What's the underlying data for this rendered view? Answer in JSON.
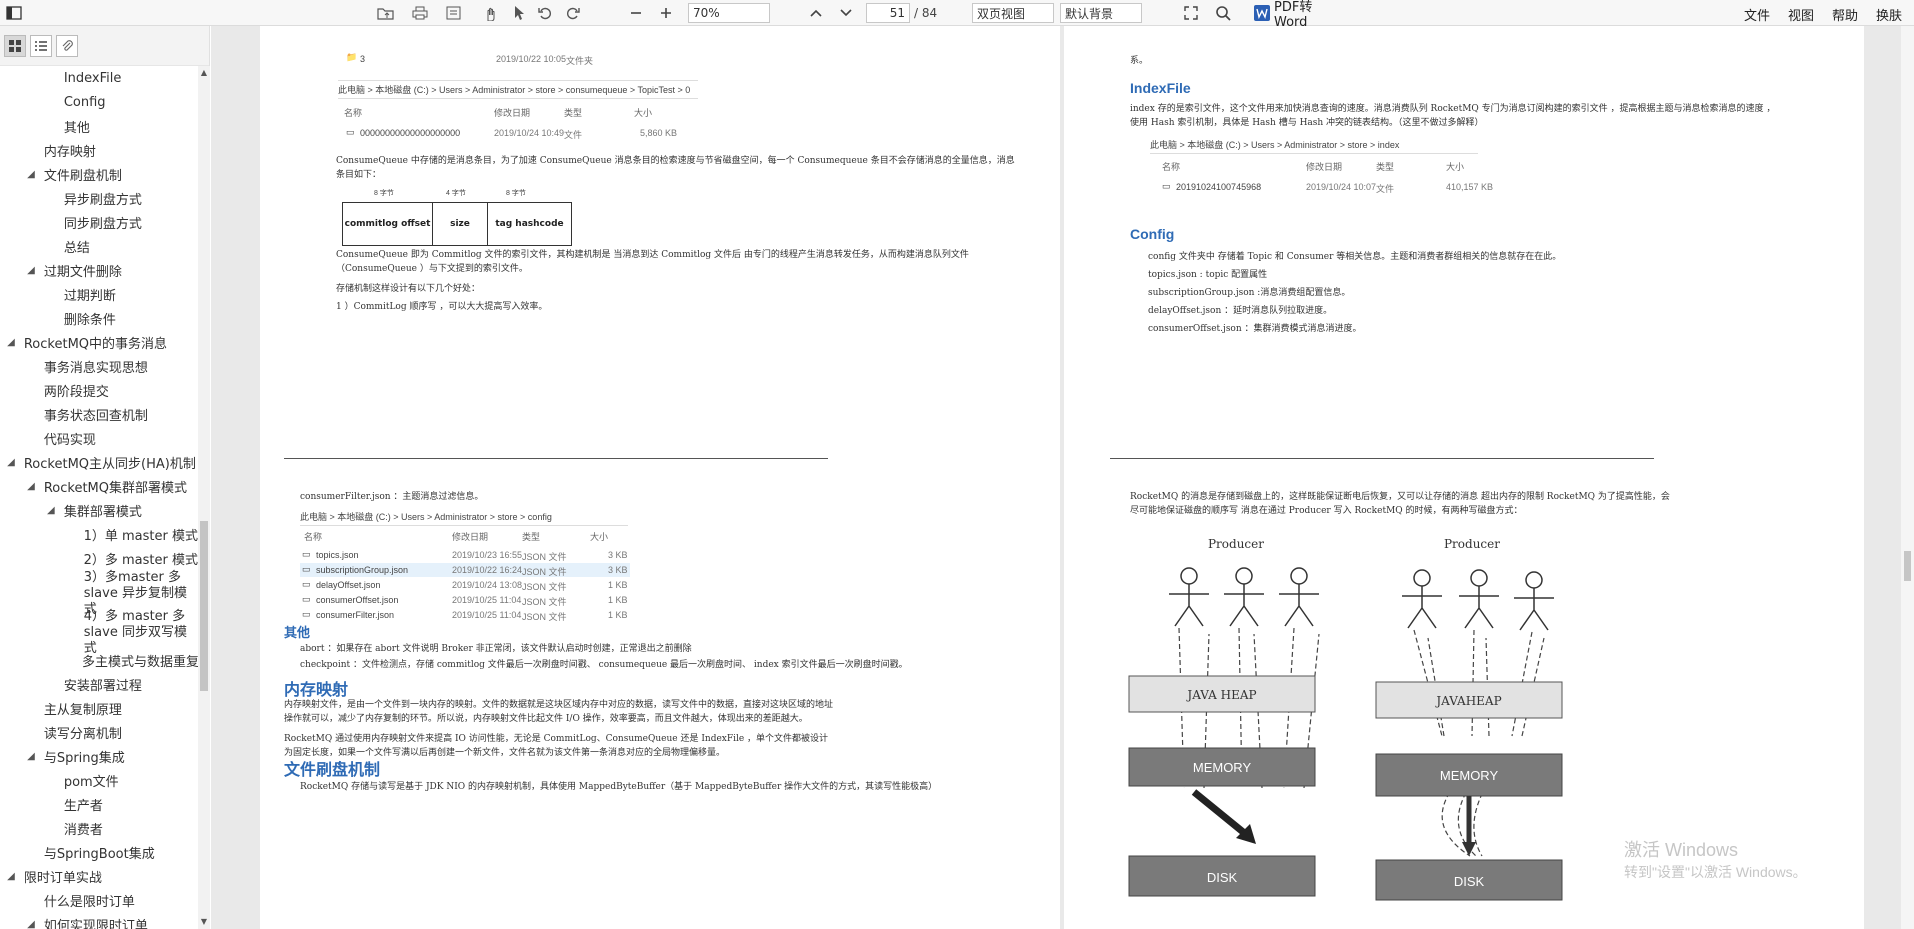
{
  "toolbar": {
    "zoom": "70%",
    "page_current": "51",
    "page_total": "/ 84",
    "view_mode": "双页视图",
    "background": "默认背景",
    "pdf_to_word": "PDF转Word",
    "menus": [
      "文件",
      "视图",
      "帮助",
      "换肤"
    ]
  },
  "sidebar": {
    "items": [
      {
        "label": "IndexFile",
        "level": 3,
        "arrow": ""
      },
      {
        "label": "Config",
        "level": 3,
        "arrow": ""
      },
      {
        "label": "其他",
        "level": 3,
        "arrow": ""
      },
      {
        "label": "内存映射",
        "level": 2,
        "arrow": ""
      },
      {
        "label": "文件刷盘机制",
        "level": 2,
        "arrow": "◢"
      },
      {
        "label": "异步刷盘方式",
        "level": 3,
        "arrow": ""
      },
      {
        "label": "同步刷盘方式",
        "level": 3,
        "arrow": ""
      },
      {
        "label": "总结",
        "level": 3,
        "arrow": ""
      },
      {
        "label": "过期文件删除",
        "level": 2,
        "arrow": "◢"
      },
      {
        "label": "过期判断",
        "level": 3,
        "arrow": ""
      },
      {
        "label": "删除条件",
        "level": 3,
        "arrow": ""
      },
      {
        "label": "RocketMQ中的事务消息",
        "level": 1,
        "arrow": "◢"
      },
      {
        "label": "事务消息实现思想",
        "level": 2,
        "arrow": ""
      },
      {
        "label": "两阶段提交",
        "level": 2,
        "arrow": ""
      },
      {
        "label": "事务状态回查机制",
        "level": 2,
        "arrow": ""
      },
      {
        "label": "代码实现",
        "level": 2,
        "arrow": ""
      },
      {
        "label": "RocketMQ主从同步(HA)机制",
        "level": 1,
        "arrow": "◢"
      },
      {
        "label": "RocketMQ集群部署模式",
        "level": 2,
        "arrow": "◢"
      },
      {
        "label": "集群部署模式",
        "level": 3,
        "arrow": "◢"
      },
      {
        "label": "1）单 master 模式",
        "level": 4,
        "arrow": ""
      },
      {
        "label": "2）多 master 模式",
        "level": 4,
        "arrow": ""
      },
      {
        "label": "3）多master 多 slave 异步复制模式",
        "level": 4,
        "arrow": "",
        "multi": true
      },
      {
        "label": "4）多 master 多 slave 同步双写模式",
        "level": 4,
        "arrow": "",
        "multi": true
      },
      {
        "label": "多主模式与数据重复",
        "level": 4,
        "arrow": ""
      },
      {
        "label": "安装部署过程",
        "level": 3,
        "arrow": ""
      },
      {
        "label": "主从复制原理",
        "level": 2,
        "arrow": ""
      },
      {
        "label": "读写分离机制",
        "level": 2,
        "arrow": ""
      },
      {
        "label": "与Spring集成",
        "level": 2,
        "arrow": "◢"
      },
      {
        "label": "pom文件",
        "level": 3,
        "arrow": ""
      },
      {
        "label": "生产者",
        "level": 3,
        "arrow": ""
      },
      {
        "label": "消费者",
        "level": 3,
        "arrow": ""
      },
      {
        "label": "与SpringBoot集成",
        "level": 2,
        "arrow": ""
      },
      {
        "label": "限时订单实战",
        "level": 1,
        "arrow": "◢"
      },
      {
        "label": "什么是限时订单",
        "level": 2,
        "arrow": ""
      },
      {
        "label": "如何实现限时订单",
        "level": 2,
        "arrow": "◢"
      }
    ]
  },
  "page1": {
    "top_file": "3",
    "top_date": "2019/10/22 10:05",
    "top_type": "文件夹",
    "breadcrumb": "此电脑 > 本地磁盘 (C:) > Users > Administrator > store > consumequeue > TopicTest > 0",
    "col_name": "名称",
    "col_date": "修改日期",
    "col_type": "类型",
    "col_size": "大小",
    "file_name": "00000000000000000000",
    "file_date": "2019/10/24 10:49",
    "file_type": "文件",
    "file_size": "5,860 KB",
    "para1": "ConsumeQueue 中存储的是消息条目，为了加速 ConsumeQueue 消息条目的检索速度与节省磁盘空间，每一个 Consumequeue 条目不会存储消息的全量信息，消息条目如下：",
    "box_labels": [
      "8 字节",
      "4 字节",
      "8 字节"
    ],
    "box_cells": [
      "commitlog offset",
      "size",
      "tag hashcode"
    ],
    "para2": "ConsumeQueue 即为 Commitlog 文件的索引文件，其构建机制是 当消息到达 Commitlog 文件后 由专门的线程产生消息转发任务，从而构建消息队列文件（ConsumeQueue ）与下文提到的索引文件。",
    "para3": "存储机制这样设计有以下几个好处：",
    "para4": "1 ）CommitLog 顺序写 ，可以大大提高写入效率。"
  },
  "page2": {
    "top_tail": "系。",
    "heading_index": "IndexFile",
    "para_index": "index 存的是索引文件，这个文件用来加快消息查询的速度。消息消费队列 RocketMQ 专门为消息订阅构建的索引文件 ，提高根据主题与消息检索消息的速度 ，使用 Hash 索引机制，具体是 Hash 槽与 Hash 冲突的链表结构。（这里不做过多解释）",
    "breadcrumb": "此电脑 > 本地磁盘 (C:) > Users > Administrator > store > index",
    "col_name": "名称",
    "col_date": "修改日期",
    "col_type": "类型",
    "col_size": "大小",
    "file_name": "20191024100745968",
    "file_date": "2019/10/24 10:07",
    "file_type": "文件",
    "file_size": "410,157 KB",
    "heading_config": "Config",
    "config_lines": [
      "config 文件夹中 存储着 Topic 和 Consumer 等相关信息。主题和消费者群组相关的信息就存在在此。",
      "topics.json : topic 配置属性",
      "subscriptionGroup.json :消息消费组配置信息。",
      "delayOffset.json ：延时消息队列拉取进度。",
      "consumerOffset.json ：集群消费模式消息消进度。"
    ]
  },
  "page3": {
    "line_consumer_filter": "consumerFilter.json ：主题消息过滤信息。",
    "breadcrumb": "此电脑 > 本地磁盘 (C:) > Users > Administrator > store > config",
    "col_name": "名称",
    "col_date": "修改日期",
    "col_type": "类型",
    "col_size": "大小",
    "files": [
      {
        "name": "topics.json",
        "date": "2019/10/23 16:55",
        "type": "JSON 文件",
        "size": "3 KB"
      },
      {
        "name": "subscriptionGroup.json",
        "date": "2019/10/22 16:24",
        "type": "JSON 文件",
        "size": "3 KB"
      },
      {
        "name": "delayOffset.json",
        "date": "2019/10/24 13:08",
        "type": "JSON 文件",
        "size": "1 KB"
      },
      {
        "name": "consumerOffset.json",
        "date": "2019/10/25 11:04",
        "type": "JSON 文件",
        "size": "1 KB"
      },
      {
        "name": "consumerFilter.json",
        "date": "2019/10/25 11:04",
        "type": "JSON 文件",
        "size": "1 KB"
      }
    ],
    "heading_other": "其他",
    "other_lines": [
      "abort ：如果存在 abort 文件说明 Broker 非正常闭，该文件默认启动时创建，正常退出之前删除",
      "checkpoint ：文件检测点，存储 commitlog 文件最后一次刷盘时间戳、 consumequeue 最后一次刷盘时间、 index 索引文件最后一次刷盘时间戳。"
    ],
    "heading_mmap": "内存映射",
    "mmap_p1": "内存映射文件，是由一个文件到一块内存的映射。文件的数据就是这块区域内存中对应的数据，读写文件中的数据，直接对这块区域的地址操作就可以，减少了内存复制的环节。所以说，内存映射文件比起文件 I/O 操作，效率要高，而且文件越大，体现出来的差距越大。",
    "mmap_p2": "RocketMQ 通过使用内存映射文件来提高 IO 访问性能，无论是 CommitLog、ConsumeQueue 还是 IndexFile ，单个文件都被设计为固定长度，如果一个文件写满以后再创建一个新文件，文件名就为该文件第一条消息对应的全局物理偏移量。",
    "heading_flush": "文件刷盘机制",
    "flush_p1": "RocketMQ 存储与读写是基于 JDK NIO 的内存映射机制，具体使用 MappedByteBuffer（基于 MappedByteBuffer 操作大文件的方式，其读写性能极高）"
  },
  "page4": {
    "para": "RocketMQ 的消息是存储到磁盘上的，这样既能保证断电后恢复，又可以让存储的消息 超出内存的限制 RocketMQ 为了提高性能，会尽可能地保证磁盘的顺序写 消息在通过 Producer 写入 RocketMQ 的时候，有两种写磁盘方式：",
    "diagram_left": {
      "title": "Producer",
      "heap": "JAVA     HEAP",
      "memory": "MEMORY",
      "disk": "DISK"
    },
    "diagram_right": {
      "title": "Producer",
      "heap": "JAVAHEAP",
      "memory": "MEMORY",
      "disk": "DISK"
    }
  },
  "watermark": {
    "line1": "激活 Windows",
    "line2": "转到\"设置\"以激活 Windows。"
  }
}
